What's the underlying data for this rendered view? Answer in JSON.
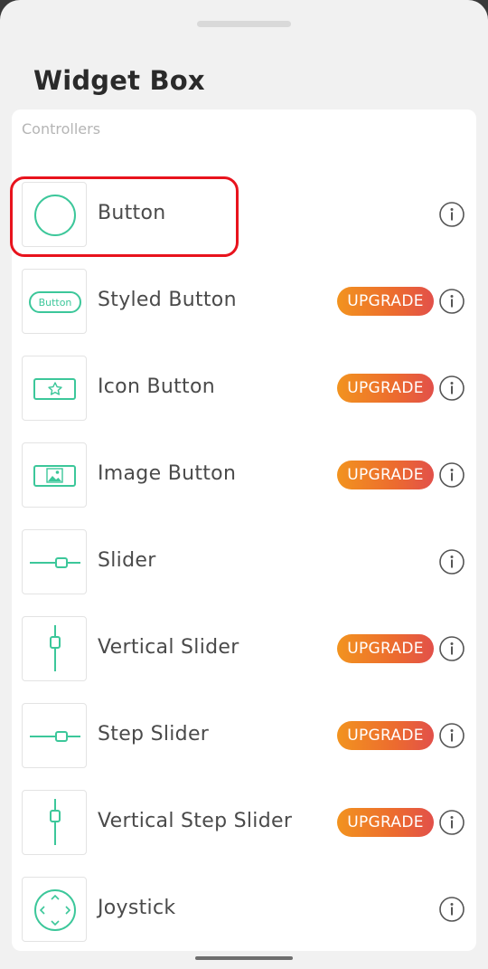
{
  "header": {
    "title": "Widget Box"
  },
  "section": {
    "label": "Controllers"
  },
  "widgets": [
    {
      "label": "Button",
      "upgrade": false
    },
    {
      "label": "Styled Button",
      "upgrade": true,
      "thumb_text": "Button"
    },
    {
      "label": "Icon Button",
      "upgrade": true
    },
    {
      "label": "Image Button",
      "upgrade": true
    },
    {
      "label": "Slider",
      "upgrade": false
    },
    {
      "label": "Vertical Slider",
      "upgrade": true
    },
    {
      "label": "Step Slider",
      "upgrade": true
    },
    {
      "label": "Vertical Step Slider",
      "upgrade": true
    },
    {
      "label": "Joystick",
      "upgrade": false
    }
  ],
  "upgrade_label": "UPGRADE",
  "icons": [
    "circle-button-icon",
    "styled-button-icon",
    "icon-button-icon",
    "image-button-icon",
    "slider-icon",
    "vertical-slider-icon",
    "step-slider-icon",
    "vertical-step-slider-icon",
    "joystick-icon",
    "info-icon"
  ],
  "colors": {
    "accent": "#3cc79a",
    "upgrade_start": "#f2931f",
    "upgrade_end": "#e2504a",
    "highlight": "#e8131d"
  }
}
